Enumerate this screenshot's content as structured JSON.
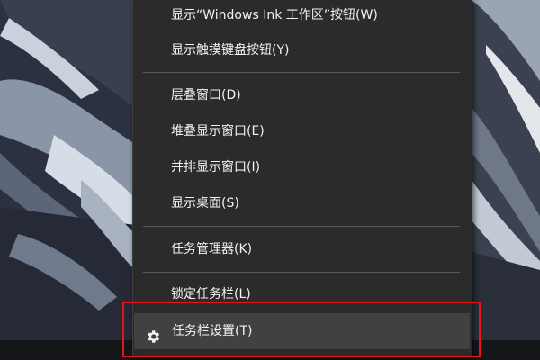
{
  "menu": {
    "items": [
      {
        "label": "显示“Windows Ink 工作区”按钮(W)"
      },
      {
        "label": "显示触摸键盘按钮(Y)"
      },
      {
        "label": "层叠窗口(D)"
      },
      {
        "label": "堆叠显示窗口(E)"
      },
      {
        "label": "并排显示窗口(I)"
      },
      {
        "label": "显示桌面(S)"
      },
      {
        "label": "任务管理器(K)"
      },
      {
        "label": "锁定任务栏(L)"
      },
      {
        "label": "任务栏设置(T)",
        "icon": "gear-icon",
        "hovered": true
      }
    ]
  },
  "colors": {
    "menu_bg": "#2b2b2b",
    "hover_bg": "#414141",
    "text": "#f2f2f2",
    "separator": "#5a5a5a",
    "highlight_border": "#e8141b"
  }
}
